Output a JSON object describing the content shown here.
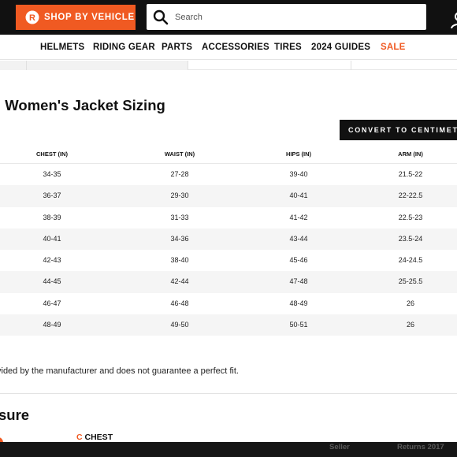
{
  "header": {
    "shop_by_vehicle": "SHOP BY VEHICLE",
    "search_placeholder": "Search",
    "colors": {
      "accent": "#f05a22",
      "bar": "#111111"
    }
  },
  "nav": {
    "items": [
      "HELMETS",
      "RIDING GEAR",
      "PARTS",
      "ACCESSORIES",
      "TIRES",
      "2024 GUIDES"
    ],
    "sale": "SALE"
  },
  "size_chart": {
    "title": "l Women's Jacket Sizing",
    "convert_button": "CONVERT TO CENTIMETERS",
    "headers": [
      "CHEST (IN)",
      "WAIST (IN)",
      "HIPS (IN)",
      "ARM (IN)"
    ],
    "rows": [
      [
        "34-35",
        "27-28",
        "39-40",
        "21.5-22"
      ],
      [
        "36-37",
        "29-30",
        "40-41",
        "22-22.5"
      ],
      [
        "38-39",
        "31-33",
        "41-42",
        "22.5-23"
      ],
      [
        "40-41",
        "34-36",
        "43-44",
        "23.5-24"
      ],
      [
        "42-43",
        "38-40",
        "45-46",
        "24-24.5"
      ],
      [
        "44-45",
        "42-44",
        "47-48",
        "25-25.5"
      ],
      [
        "46-47",
        "46-48",
        "48-49",
        "26"
      ],
      [
        "48-49",
        "49-50",
        "50-51",
        "26"
      ]
    ]
  },
  "disclaimer": "vided by the manufacturer and does not guarantee a perfect fit.",
  "measure": {
    "title": "sure",
    "chest_letter": "C",
    "chest_label": "CHEST"
  },
  "bottom_bar": {
    "left_text": "Seller",
    "right_text": "Returns 2017"
  }
}
